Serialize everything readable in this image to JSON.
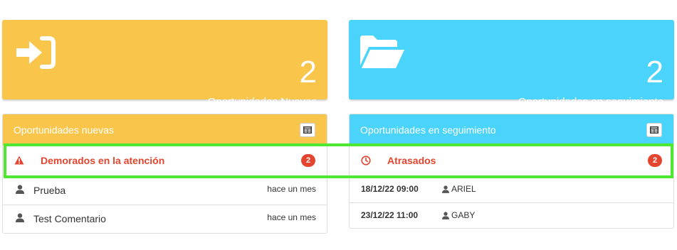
{
  "cards": {
    "nuevas": {
      "count": "2",
      "label": "Oportunidades Nuevas",
      "color": "#f9c54b",
      "icon": "sign-in-icon"
    },
    "seguimiento": {
      "count": "2",
      "label": "Oportunidades en seguimiento",
      "color": "#4bd4fb",
      "icon": "folder-open-icon"
    }
  },
  "left_panel": {
    "title": "Oportunidades nuevas",
    "alert": {
      "text": "Demorados en la atención",
      "count": "2",
      "icon": "warning-icon"
    },
    "items": [
      {
        "name": "Prueba",
        "time": "hace un mes"
      },
      {
        "name": "Test Comentario",
        "time": "hace un mes"
      }
    ]
  },
  "right_panel": {
    "title": "Oportunidades en seguimiento",
    "alert": {
      "text": "Atrasados",
      "count": "2",
      "icon": "clock-icon"
    },
    "items": [
      {
        "date": "18/12/22 09:00",
        "user": "ARIEL"
      },
      {
        "date": "23/12/22 11:00",
        "user": "GABY"
      }
    ]
  },
  "colors": {
    "alert": "#e3452f",
    "highlight": "#4ee833"
  }
}
